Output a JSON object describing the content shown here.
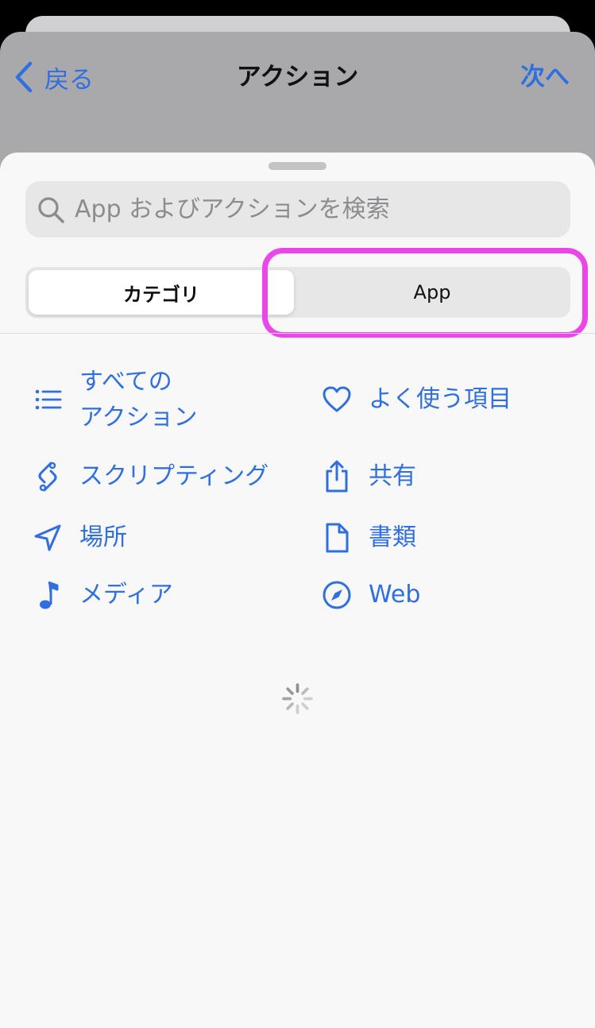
{
  "navbar": {
    "back_label": "戻る",
    "title": "アクション",
    "next_label": "次へ"
  },
  "search": {
    "placeholder": "App およびアクションを検索"
  },
  "segments": {
    "category_label": "カテゴリ",
    "app_label": "App",
    "selected": "カテゴリ"
  },
  "categories": [
    {
      "label": "すべての\nアクション",
      "icon": "list-icon"
    },
    {
      "label": "よく使う項目",
      "icon": "heart-icon"
    },
    {
      "label": "スクリプティング",
      "icon": "scripting-icon"
    },
    {
      "label": "共有",
      "icon": "share-icon"
    },
    {
      "label": "場所",
      "icon": "location-arrow-icon"
    },
    {
      "label": "書類",
      "icon": "document-icon"
    },
    {
      "label": "メディア",
      "icon": "music-note-icon"
    },
    {
      "label": "Web",
      "icon": "compass-icon"
    }
  ],
  "colors": {
    "accent": "#2f6fe0",
    "highlight": "#ea46ea"
  }
}
